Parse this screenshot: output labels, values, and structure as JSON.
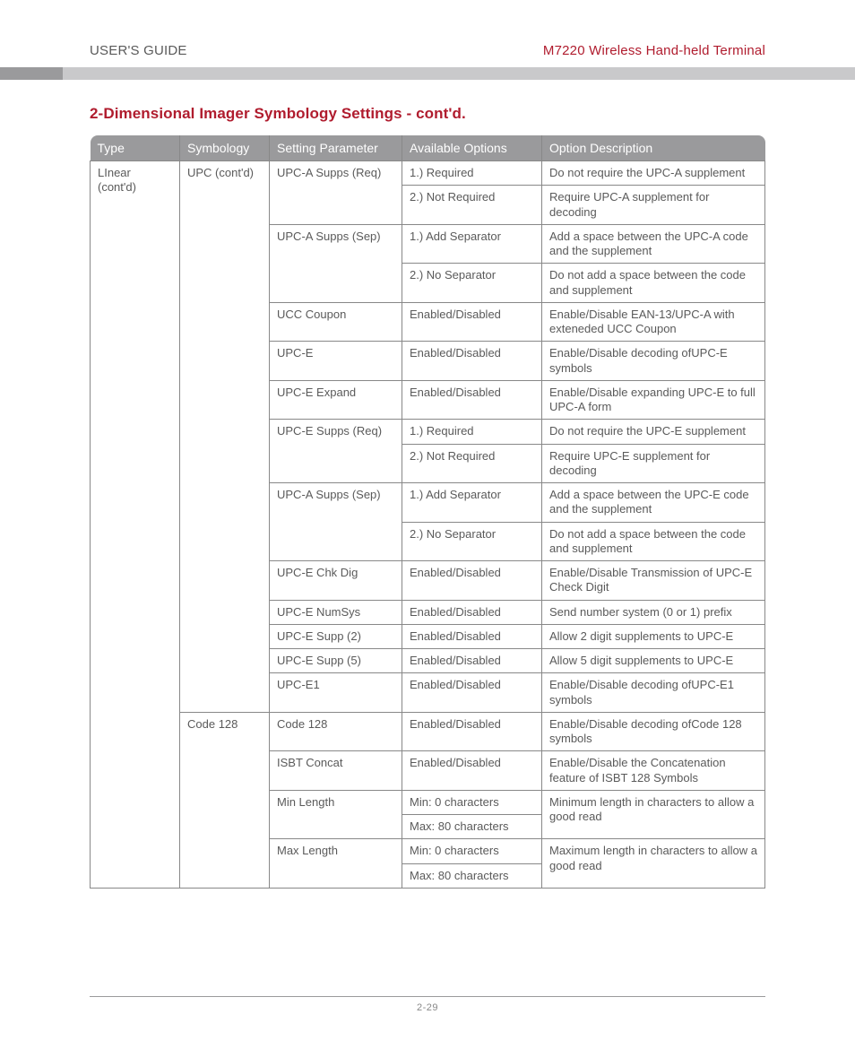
{
  "header": {
    "left": "USER'S GUIDE",
    "right": "M7220 Wireless Hand-held Terminal"
  },
  "section_title": "2-Dimensional Imager Symbology Settings - cont'd.",
  "table": {
    "headers": [
      "Type",
      "Symbology",
      "Setting Parameter",
      "Available Options",
      "Option Description"
    ],
    "type_col": "LInear (cont'd)",
    "groups": [
      {
        "symbology": "UPC (cont'd)",
        "rows": [
          {
            "param": "UPC-A Supps (Req)",
            "param_span": 2,
            "option": "1.) Required",
            "desc": "Do not require the UPC-A supplement"
          },
          {
            "option": "2.) Not Required",
            "desc": "Require UPC-A supplement for decoding"
          },
          {
            "param": "UPC-A Supps (Sep)",
            "param_span": 2,
            "option": "1.) Add Separator",
            "desc": "Add a space between the UPC-A code and the supplement"
          },
          {
            "option": "2.) No Separator",
            "desc": "Do not add a space between the code and supplement"
          },
          {
            "param": "UCC Coupon",
            "option": "Enabled/Disabled",
            "desc": "Enable/Disable EAN-13/UPC-A with exteneded UCC Coupon"
          },
          {
            "param": "UPC-E",
            "option": "Enabled/Disabled",
            "desc": "Enable/Disable decoding ofUPC-E symbols"
          },
          {
            "param": "UPC-E Expand",
            "option": "Enabled/Disabled",
            "desc": "Enable/Disable expanding UPC-E to full UPC-A form"
          },
          {
            "param": "UPC-E Supps (Req)",
            "param_span": 2,
            "option": "1.) Required",
            "desc": "Do not require the UPC-E supplement"
          },
          {
            "option": "2.) Not Required",
            "desc": "Require UPC-E supplement for decoding"
          },
          {
            "param": "UPC-A Supps (Sep)",
            "param_span": 2,
            "option": "1.) Add Separator",
            "desc": "Add a space between the UPC-E code and the supplement"
          },
          {
            "option": "2.) No Separator",
            "desc": "Do not add a space between the code and supplement"
          },
          {
            "param": "UPC-E Chk Dig",
            "option": "Enabled/Disabled",
            "desc": "Enable/Disable Transmission of UPC-E Check Digit"
          },
          {
            "param": "UPC-E NumSys",
            "option": "Enabled/Disabled",
            "desc": "Send number system (0 or 1) prefix"
          },
          {
            "param": "UPC-E Supp (2)",
            "option": "Enabled/Disabled",
            "desc": "Allow 2 digit supplements to UPC-E"
          },
          {
            "param": "UPC-E Supp (5)",
            "option": "Enabled/Disabled",
            "desc": "Allow 5 digit supplements to UPC-E"
          },
          {
            "param": "UPC-E1",
            "option": "Enabled/Disabled",
            "desc": "Enable/Disable decoding ofUPC-E1 symbols"
          }
        ]
      },
      {
        "symbology": "Code 128",
        "rows": [
          {
            "param": "Code 128",
            "option": "Enabled/Disabled",
            "desc": "Enable/Disable decoding ofCode 128 symbols"
          },
          {
            "param": "ISBT Concat",
            "option": "Enabled/Disabled",
            "desc": "Enable/Disable the Concatenation feature of ISBT 128 Symbols"
          },
          {
            "param": "Min Length",
            "param_span": 2,
            "option": "Min: 0 characters",
            "desc": "Minimum length in characters to allow a good read",
            "desc_span": 2
          },
          {
            "option": "Max: 80 characters"
          },
          {
            "param": "Max Length",
            "param_span": 2,
            "option": "Min: 0 characters",
            "desc": "Maximum length in characters to allow a good read",
            "desc_span": 2
          },
          {
            "option": "Max: 80 characters"
          }
        ]
      }
    ]
  },
  "footer": {
    "page": "2-29"
  }
}
